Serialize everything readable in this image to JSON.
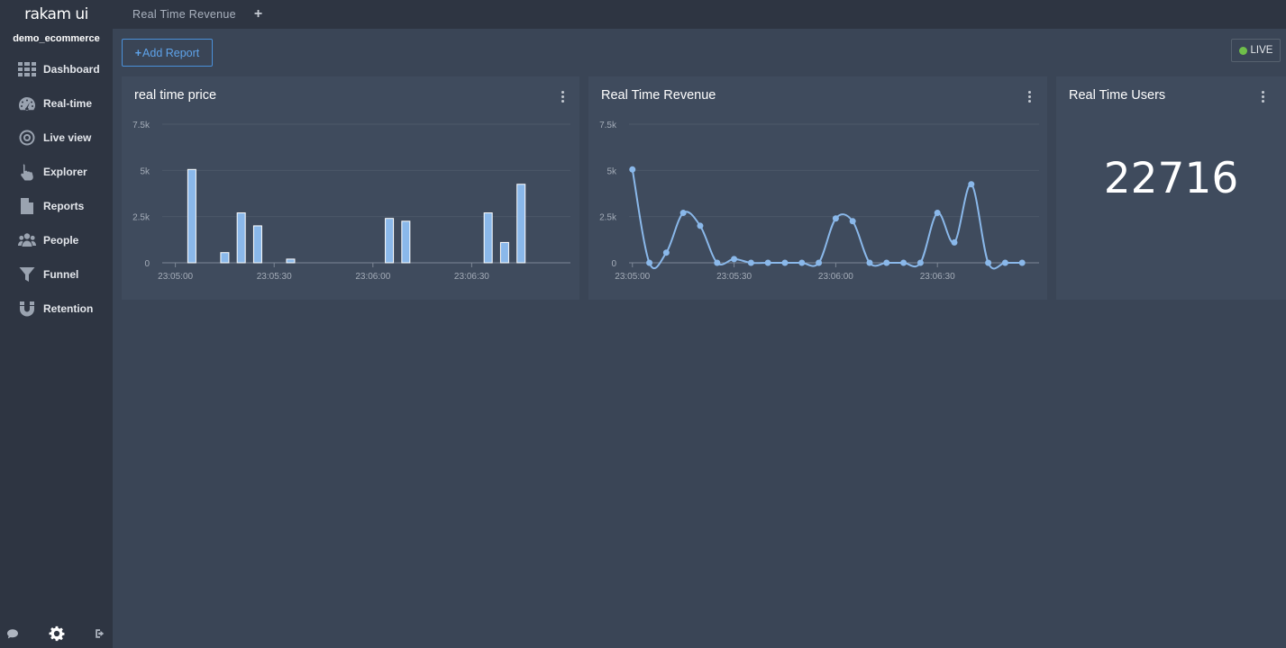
{
  "app": {
    "brand": "rakam ui",
    "project": "demo_ecommerce"
  },
  "sidebar": {
    "items": [
      {
        "label": "Dashboard",
        "icon": "grid-icon"
      },
      {
        "label": "Real-time",
        "icon": "gauge-icon"
      },
      {
        "label": "Live view",
        "icon": "target-icon"
      },
      {
        "label": "Explorer",
        "icon": "pointer-hand-icon"
      },
      {
        "label": "Reports",
        "icon": "document-icon"
      },
      {
        "label": "People",
        "icon": "people-icon"
      },
      {
        "label": "Funnel",
        "icon": "funnel-icon"
      },
      {
        "label": "Retention",
        "icon": "magnet-icon"
      }
    ]
  },
  "topbar": {
    "tab": "Real Time Revenue",
    "add_tab": "+"
  },
  "toolbar": {
    "add_report": "Add Report",
    "live": "LIVE",
    "live_color": "#6fbf4a"
  },
  "colors": {
    "accent": "#4a90d9",
    "series": "#8ab8ea",
    "background": "#3a4556",
    "card": "#3f4b5d",
    "sidebar": "#2e3542"
  },
  "cards": {
    "price": {
      "title": "real time price"
    },
    "revenue": {
      "title": "Real Time Revenue"
    },
    "users": {
      "title": "Real Time Users",
      "value": "22716"
    }
  },
  "chart_data": [
    {
      "type": "bar",
      "title": "real time price",
      "ylim": [
        0,
        7500
      ],
      "y_ticks": [
        0,
        2500,
        5000,
        7500
      ],
      "y_tick_labels": [
        "0",
        "2.5k",
        "5k",
        "7.5k"
      ],
      "x_range": [
        -4,
        120
      ],
      "x_ticks": [
        0,
        30,
        60,
        90
      ],
      "x_tick_labels": [
        "23:05:00",
        "23:05:30",
        "23:06:00",
        "23:06:30"
      ],
      "grid": true,
      "x": [
        5,
        15,
        20,
        25,
        35,
        65,
        70,
        95,
        100,
        105
      ],
      "values": [
        5050,
        550,
        2700,
        2000,
        200,
        2400,
        2250,
        2700,
        1100,
        4250
      ]
    },
    {
      "type": "line",
      "title": "Real Time Revenue",
      "ylim": [
        0,
        7500
      ],
      "y_ticks": [
        0,
        2500,
        5000,
        7500
      ],
      "y_tick_labels": [
        "0",
        "2.5k",
        "5k",
        "7.5k"
      ],
      "x_range": [
        -1,
        120
      ],
      "x_ticks": [
        0,
        30,
        60,
        90
      ],
      "x_tick_labels": [
        "23:05:00",
        "23:05:30",
        "23:06:00",
        "23:06:30"
      ],
      "grid": true,
      "x": [
        0,
        5,
        10,
        15,
        20,
        25,
        30,
        35,
        40,
        45,
        50,
        55,
        60,
        65,
        70,
        75,
        80,
        85,
        90,
        95,
        100,
        105,
        110,
        115
      ],
      "values": [
        5050,
        0,
        550,
        2700,
        2000,
        0,
        200,
        0,
        0,
        0,
        0,
        0,
        2400,
        2250,
        0,
        0,
        0,
        0,
        2700,
        1100,
        4250,
        0,
        0,
        0
      ]
    }
  ]
}
